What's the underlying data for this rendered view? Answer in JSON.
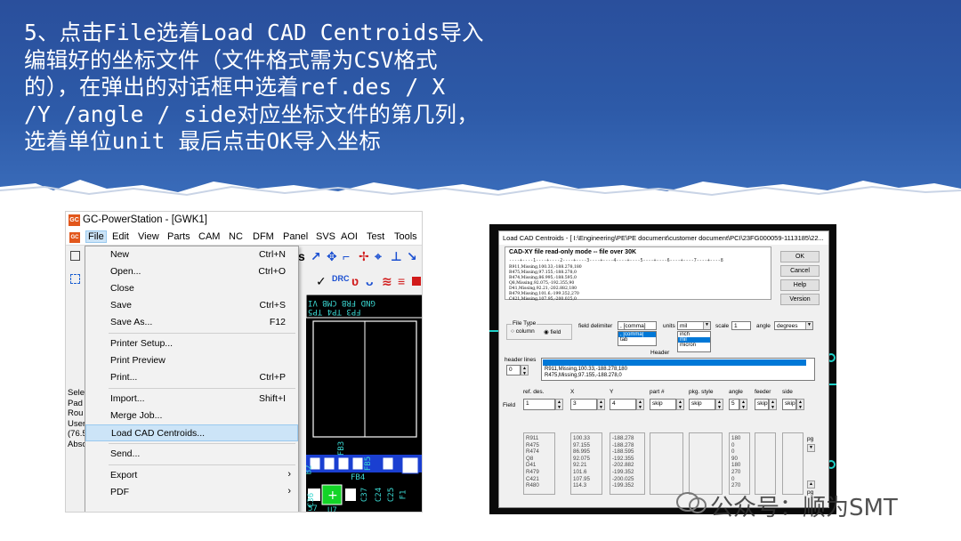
{
  "slide": {
    "instruction_lines": [
      "5、点击File选着Load CAD Centroids导入",
      "编辑好的坐标文件（文件格式需为CSV格式",
      "的），在弹出的对话框中选着ref.des / X",
      "/Y /angle / side对应坐标文件的第几列，",
      "选着单位unit 最后点击OK导入坐标"
    ],
    "banner_color": "#2d5aa8",
    "watermark": "公众号：顺为SMT"
  },
  "gc_window": {
    "logo": "GC",
    "title": "GC-PowerStation - [GWK1]",
    "menus": [
      "File",
      "Edit",
      "View",
      "Parts",
      "CAM",
      "NC",
      "DFM",
      "Panel",
      "SVS",
      "AOI",
      "Test",
      "Tools"
    ],
    "left_panel_lines": [
      "Sele",
      "Pad",
      "Rou",
      "User",
      "(76.5",
      "Absc"
    ],
    "canvas_labels": {
      "top_row": "FP3 TP4 TP5",
      "top_row2": "GND FRB CMB VI",
      "parts": [
        "FB3",
        "B2",
        "FB4",
        "FB5",
        "C37",
        "C24",
        "C25",
        "F1",
        "U7",
        "C36",
        "57"
      ]
    },
    "file_menu": [
      {
        "label": "New",
        "shortcut": "Ctrl+N"
      },
      {
        "label": "Open...",
        "shortcut": "Ctrl+O"
      },
      {
        "label": "Close",
        "shortcut": ""
      },
      {
        "label": "Save",
        "shortcut": "Ctrl+S"
      },
      {
        "label": "Save As...",
        "shortcut": "F12"
      },
      {
        "label": "Printer Setup...",
        "shortcut": ""
      },
      {
        "label": "Print Preview",
        "shortcut": ""
      },
      {
        "label": "Print...",
        "shortcut": "Ctrl+P"
      },
      {
        "label": "Import...",
        "shortcut": "Shift+I"
      },
      {
        "label": "Merge Job...",
        "shortcut": ""
      },
      {
        "label": "Load CAD Centroids...",
        "shortcut": "",
        "highlighted": true
      },
      {
        "label": "Send...",
        "shortcut": ""
      },
      {
        "label": "Export",
        "submenu": true
      },
      {
        "label": "PDF",
        "submenu": true
      }
    ]
  },
  "dialog": {
    "title": "Load CAD Centroids - [ I:\\Engineering\\PE\\PE document\\customer document\\PCI\\23FG000059-1113185\\22...",
    "preview_title": "CAD-XY file read-only mode -- file over 30K",
    "preview_ruler": "----+----1----+----2----+----3----+----4----+----5----+----6----+----7----+----8",
    "preview_lines": [
      "R911,Missing,100.33,-188.278,180",
      "R475,Missing,97.155,-188.278,0",
      "R474,Missing,86.995,-188.595,0",
      "Q8,Missing,92.075,-192.355,90",
      "D41,Missing,92.21,-202.882,180",
      "R479,Missing,101.6,-199.352,270",
      "C421,Missing,107.95,-200.025,0"
    ],
    "buttons": {
      "ok": "OK",
      "cancel": "Cancel",
      "help": "Help",
      "version": "Version"
    },
    "file_type": {
      "label": "File Type",
      "column": "column",
      "field": "field"
    },
    "field_delimiter": {
      "label": "field delimiter",
      "value": ", [comma]",
      "options": [
        ", [comma]",
        "tab"
      ]
    },
    "units": {
      "label": "units",
      "value": "mil",
      "options": [
        "inch",
        "mil",
        "micron"
      ]
    },
    "scale": {
      "label": "scale",
      "value": "1"
    },
    "angle": {
      "label": "angle",
      "value": "degrees"
    },
    "header_group": "Header",
    "header_lines": {
      "label": "header lines",
      "value": "0"
    },
    "header_rows": [
      "R911,Missing,100.33,-188.278,180",
      "R475,Missing,97.155,-188.278,0"
    ],
    "field_row_label": "Field",
    "columns": [
      {
        "name": "ref. des.",
        "value": "1",
        "data": "R911\nR475\nR474\nQ8\nD41\nR479\nC421\nR480"
      },
      {
        "name": "X",
        "value": "3",
        "data": "100.33\n97.155\n86.995\n92.075\n92.21\n101.6\n107.95\n114.3"
      },
      {
        "name": "Y",
        "value": "4",
        "data": "-188.278\n-188.278\n-188.595\n-192.355\n-202.882\n-199.352\n-200.025\n-199.352"
      },
      {
        "name": "part #",
        "value": "skip",
        "data": ""
      },
      {
        "name": "pkg. style",
        "value": "skip",
        "data": ""
      },
      {
        "name": "angle",
        "value": "5",
        "data": "180\n0\n0\n90\n180\n270\n0\n270"
      },
      {
        "name": "feeder",
        "value": "skip",
        "data": ""
      },
      {
        "name": "side",
        "value": "skip",
        "data": ""
      }
    ],
    "side_buttons": [
      "pg",
      "pg"
    ]
  }
}
